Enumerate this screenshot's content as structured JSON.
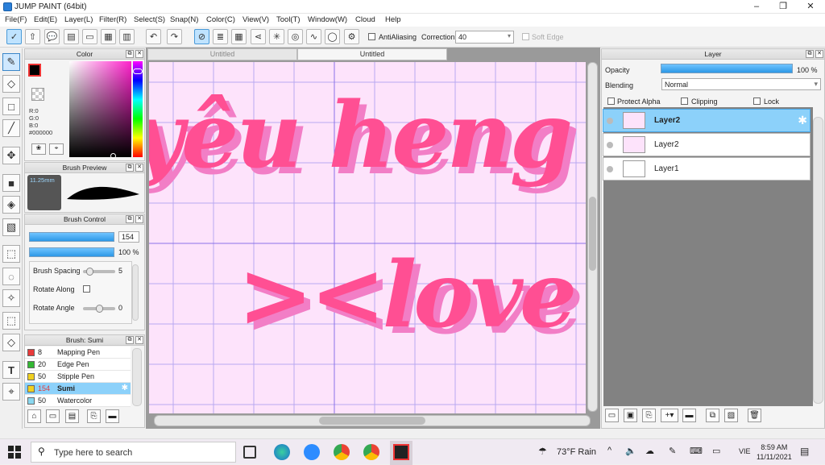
{
  "window": {
    "title": "JUMP PAINT (64bit)",
    "minimize": "–",
    "maximize": "❐",
    "close": "✕"
  },
  "menu": [
    "File(F)",
    "Edit(E)",
    "Layer(L)",
    "Filter(R)",
    "Select(S)",
    "Snap(N)",
    "Color(C)",
    "View(V)",
    "Tool(T)",
    "Window(W)",
    "Cloud",
    "Help"
  ],
  "toolbar": {
    "antialiasing_label": "AntiAliasing",
    "correction_label": "Correction",
    "correction_value": "40",
    "soft_edge_label": "Soft Edge"
  },
  "color_panel": {
    "title": "Color",
    "r": "R:0",
    "g": "G:0",
    "b": "B:0",
    "hex": "#000000"
  },
  "brush_preview": {
    "title": "Brush Preview",
    "size": "11.25mm"
  },
  "brush_control": {
    "title": "Brush Control",
    "size_value": "154",
    "opacity_value": "100 %",
    "spacing_label": "Brush Spacing",
    "spacing_value": "5",
    "rotate_along_label": "Rotate Along",
    "rotate_angle_label": "Rotate Angle",
    "rotate_angle_value": "0"
  },
  "brush_list": {
    "title": "Brush: Sumi",
    "items": [
      {
        "size": "8",
        "name": "Mapping Pen",
        "color": "#e83a3a"
      },
      {
        "size": "20",
        "name": "Edge Pen",
        "color": "#33b833"
      },
      {
        "size": "50",
        "name": "Stipple Pen",
        "color": "#f0d020"
      },
      {
        "size": "154",
        "name": "Sumi",
        "color": "#f0d020"
      },
      {
        "size": "50",
        "name": "Watercolor",
        "color": "#8ad8f0"
      }
    ]
  },
  "documents": {
    "tabs": [
      "Untitled",
      "Untitled"
    ]
  },
  "canvas": {
    "line1": "yêu heng",
    "line2": "><love"
  },
  "layer_panel": {
    "title": "Layer",
    "opacity_label": "Opacity",
    "opacity_value": "100 %",
    "blending_label": "Blending",
    "blending_value": "Normal",
    "protect_alpha": "Protect Alpha",
    "clipping": "Clipping",
    "lock": "Lock",
    "layers": [
      {
        "name": "Layer2"
      },
      {
        "name": "Layer2"
      },
      {
        "name": "Layer1"
      }
    ]
  },
  "taskbar": {
    "search_placeholder": "Type here to search",
    "weather": "73°F Rain",
    "lang": "VIE",
    "time": "8:59 AM",
    "date": "11/11/2021"
  }
}
